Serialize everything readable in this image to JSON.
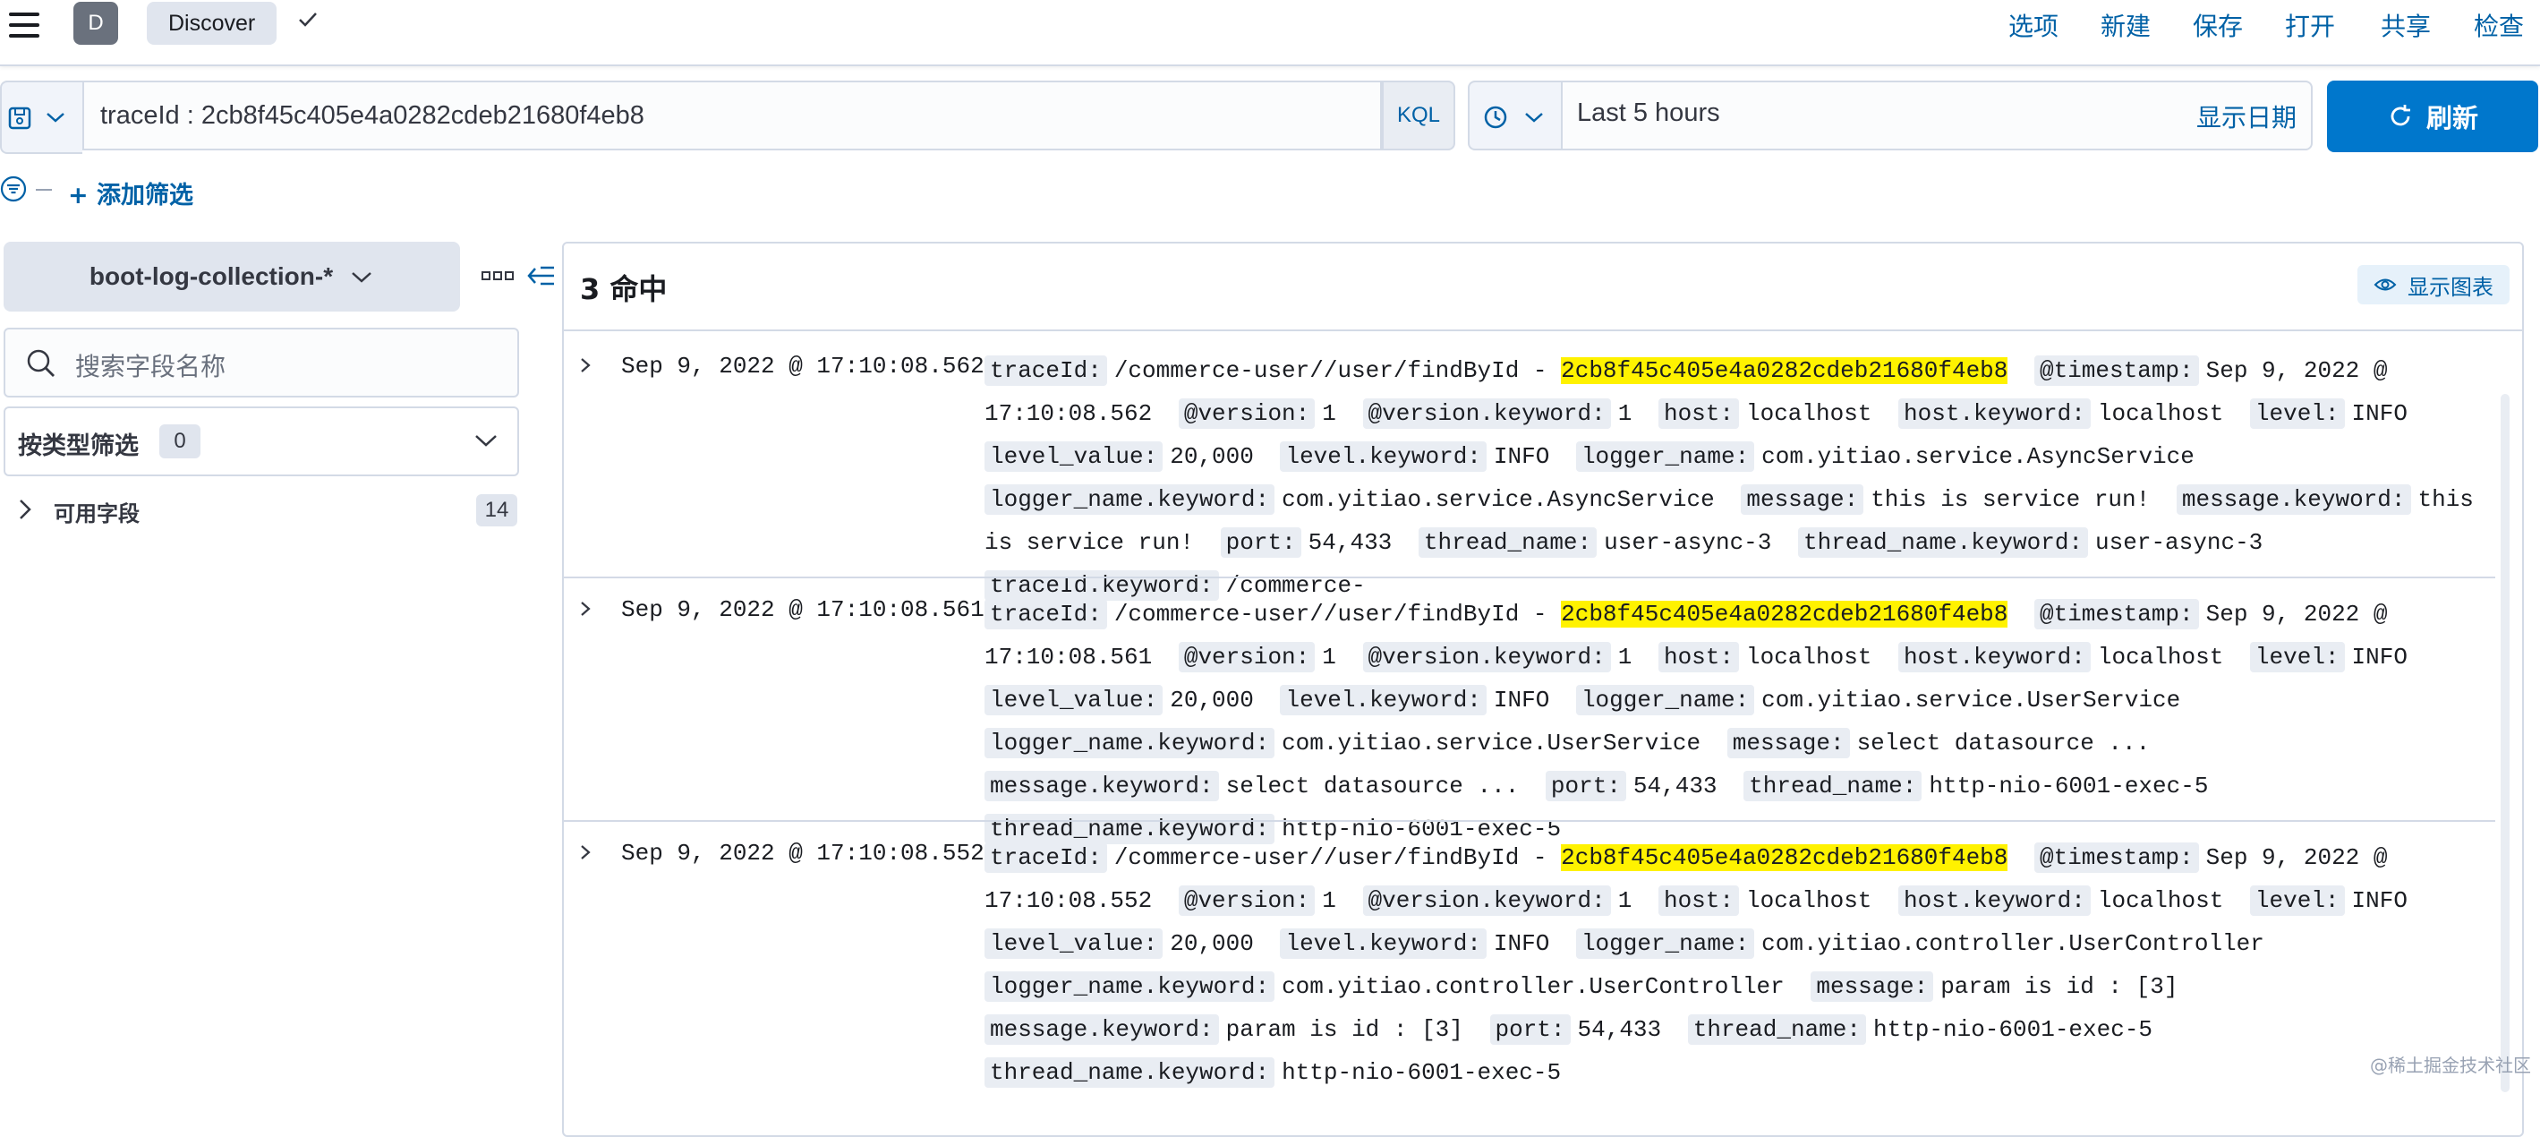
{
  "topbar": {
    "avatar_letter": "D",
    "breadcrumb": "Discover",
    "menu": [
      "选项",
      "新建",
      "保存",
      "打开",
      "共享",
      "检查"
    ]
  },
  "query": {
    "text": "traceId : 2cb8f45c405e4a0282cdeb21680f4eb8",
    "language": "KQL"
  },
  "time": {
    "range": "Last 5 hours",
    "show_dates_label": "显示日期",
    "refresh_label": "刷新"
  },
  "filters": {
    "add_label": "+ 添加筛选"
  },
  "sidebar": {
    "index_pattern": "boot-log-collection-*",
    "search_placeholder": "搜索字段名称",
    "type_filter_label": "按类型筛选",
    "type_filter_count": "0",
    "available_fields_label": "可用字段",
    "available_fields_count": "14"
  },
  "results": {
    "hits_label": "3 命中",
    "show_chart_label": "显示图表",
    "highlight": "2cb8f45c405e4a0282cdeb21680f4eb8",
    "rows": [
      {
        "timestamp": "Sep 9, 2022 @ 17:10:08.562",
        "fields": [
          {
            "k": "traceId:",
            "v": "/commerce-user//user/findById - ",
            "hl": "2cb8f45c405e4a0282cdeb21680f4eb8"
          },
          {
            "k": "@timestamp:",
            "v": "Sep 9, 2022 @ 17:10:08.562"
          },
          {
            "k": "@version:",
            "v": "1"
          },
          {
            "k": "@version.keyword:",
            "v": "1"
          },
          {
            "k": "host:",
            "v": "localhost"
          },
          {
            "k": "host.keyword:",
            "v": "localhost"
          },
          {
            "k": "level:",
            "v": "INFO"
          },
          {
            "k": "level_value:",
            "v": "20,000"
          },
          {
            "k": "level.keyword:",
            "v": "INFO"
          },
          {
            "k": "logger_name:",
            "v": "com.yitiao.service.AsyncService"
          },
          {
            "k": "logger_name.keyword:",
            "v": "com.yitiao.service.AsyncService"
          },
          {
            "k": "message:",
            "v": "this is service run!"
          },
          {
            "k": "message.keyword:",
            "v": "this is service run!"
          },
          {
            "k": "port:",
            "v": "54,433"
          },
          {
            "k": "thread_name:",
            "v": "user-async-3"
          },
          {
            "k": "thread_name.keyword:",
            "v": "user-async-3"
          },
          {
            "k": "traceId.keyword:",
            "v": "/commerce-"
          }
        ]
      },
      {
        "timestamp": "Sep 9, 2022 @ 17:10:08.561",
        "fields": [
          {
            "k": "traceId:",
            "v": "/commerce-user//user/findById - ",
            "hl": "2cb8f45c405e4a0282cdeb21680f4eb8"
          },
          {
            "k": "@timestamp:",
            "v": "Sep 9, 2022 @ 17:10:08.561"
          },
          {
            "k": "@version:",
            "v": "1"
          },
          {
            "k": "@version.keyword:",
            "v": "1"
          },
          {
            "k": "host:",
            "v": "localhost"
          },
          {
            "k": "host.keyword:",
            "v": "localhost"
          },
          {
            "k": "level:",
            "v": "INFO"
          },
          {
            "k": "level_value:",
            "v": "20,000"
          },
          {
            "k": "level.keyword:",
            "v": "INFO"
          },
          {
            "k": "logger_name:",
            "v": "com.yitiao.service.UserService"
          },
          {
            "k": "logger_name.keyword:",
            "v": "com.yitiao.service.UserService"
          },
          {
            "k": "message:",
            "v": "select datasource ..."
          },
          {
            "k": "message.keyword:",
            "v": "select datasource ..."
          },
          {
            "k": "port:",
            "v": "54,433"
          },
          {
            "k": "thread_name:",
            "v": "http-nio-6001-exec-5"
          },
          {
            "k": "thread_name.keyword:",
            "v": "http-nio-6001-exec-5"
          }
        ]
      },
      {
        "timestamp": "Sep 9, 2022 @ 17:10:08.552",
        "fields": [
          {
            "k": "traceId:",
            "v": "/commerce-user//user/findById - ",
            "hl": "2cb8f45c405e4a0282cdeb21680f4eb8"
          },
          {
            "k": "@timestamp:",
            "v": "Sep 9, 2022 @ 17:10:08.552"
          },
          {
            "k": "@version:",
            "v": "1"
          },
          {
            "k": "@version.keyword:",
            "v": "1"
          },
          {
            "k": "host:",
            "v": "localhost"
          },
          {
            "k": "host.keyword:",
            "v": "localhost"
          },
          {
            "k": "level:",
            "v": "INFO"
          },
          {
            "k": "level_value:",
            "v": "20,000"
          },
          {
            "k": "level.keyword:",
            "v": "INFO"
          },
          {
            "k": "logger_name:",
            "v": "com.yitiao.controller.UserController"
          },
          {
            "k": "logger_name.keyword:",
            "v": "com.yitiao.controller.UserController"
          },
          {
            "k": "message:",
            "v": "param is id : [3]"
          },
          {
            "k": "message.keyword:",
            "v": "param is id : [3]"
          },
          {
            "k": "port:",
            "v": "54,433"
          },
          {
            "k": "thread_name:",
            "v": "http-nio-6001-exec-5"
          },
          {
            "k": "thread_name.keyword:",
            "v": "http-nio-6001-exec-5"
          }
        ]
      }
    ]
  },
  "watermark": "@稀土掘金技术社区"
}
